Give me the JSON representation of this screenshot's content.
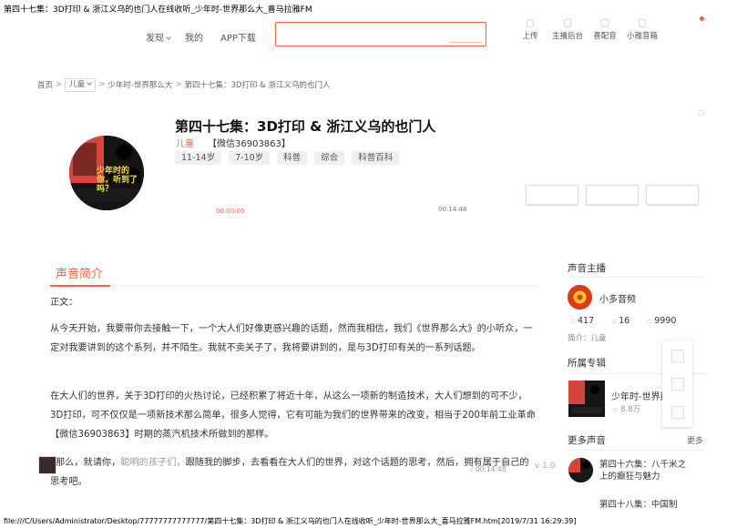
{
  "window": {
    "title": "第四十七集：3D打印 & 浙江义乌的也门人在线收听_少年时-世界那么大_喜马拉雅FM",
    "footer_path": "file:///C/Users/Administrator/Desktop/77777777777777/第四十七集：3D打印 & 浙江义乌的也门人在线收听_少年时-世界那么大_喜马拉雅FM.htm[2019/7/31 16:29:39]"
  },
  "nav": {
    "discover": "发现",
    "mine": "我的",
    "app_download": "APP下载",
    "search_placeholder": "",
    "tools": [
      "上传",
      "主播后台",
      "喜配音",
      "小雅音箱"
    ]
  },
  "breadcrumb": {
    "home": "首页",
    "sep": ">",
    "category": "儿童",
    "album": "少年时-世界那么大",
    "current": "第四十七集：3D打印 & 浙江义乌的也门人"
  },
  "track": {
    "title": "第四十七集：3D打印 & 浙江义乌的也门人",
    "category_link": "儿童",
    "wechat": "【微信36903863】",
    "tags": [
      "11-14岁",
      "7-10岁",
      "科普",
      "综合",
      "科普百科"
    ],
    "time_current": "00:00:00",
    "time_total": "00:14:48",
    "cover_text": "少年时的你，听到了吗？"
  },
  "intro": {
    "heading": "声音简介",
    "label": "正文：",
    "p1": "从今天开始，我要带你去接触一下，一个大人们好像更感兴趣的话题，然而我相信，我们《世界那么大》的小听众，一定对我要讲到的这个系列，并不陌生。我就不卖关子了，我将要讲到的，是与3D打印有关的一系列话题。",
    "p2": "在大人们的世界，关于3D打印的火热讨论，已经积累了将近十年，从这么一项新的制造技术，大人们想到的可不少，3D打印，可不仅仅是一项新技术那么简单，很多人觉得，它有可能为我们的世界带来的改变，相当于200年前工业革命【微信36903863】时期的蒸汽机技术所做到的那样。",
    "p3a": "那么，就请你，",
    "p3b": "聪明的孩子们，",
    "p3c": "跟随我的脚步，去看看在大人们的世界，对这个话题的思考，然后，拥有属于自己的思考吧。",
    "overlay_time": "/ 00:14:48",
    "overlay_version": "v 1.0"
  },
  "sidebar": {
    "anchor_heading": "声音主播",
    "anchor_name": "小多音频",
    "stats": [
      "417",
      "16",
      "9990"
    ],
    "anchor_intro": "简介：儿童",
    "album_heading": "所属专辑",
    "album_name": "少年时-世界那么大",
    "album_count": "8.8万",
    "more_heading": "更多声音",
    "more_link": "更多",
    "more_item_1": "第四十六集：八千米之上的癫狂与魅力",
    "more_item_2": "第四十八集：中国制"
  },
  "colors": {
    "accent": "#f86442"
  }
}
